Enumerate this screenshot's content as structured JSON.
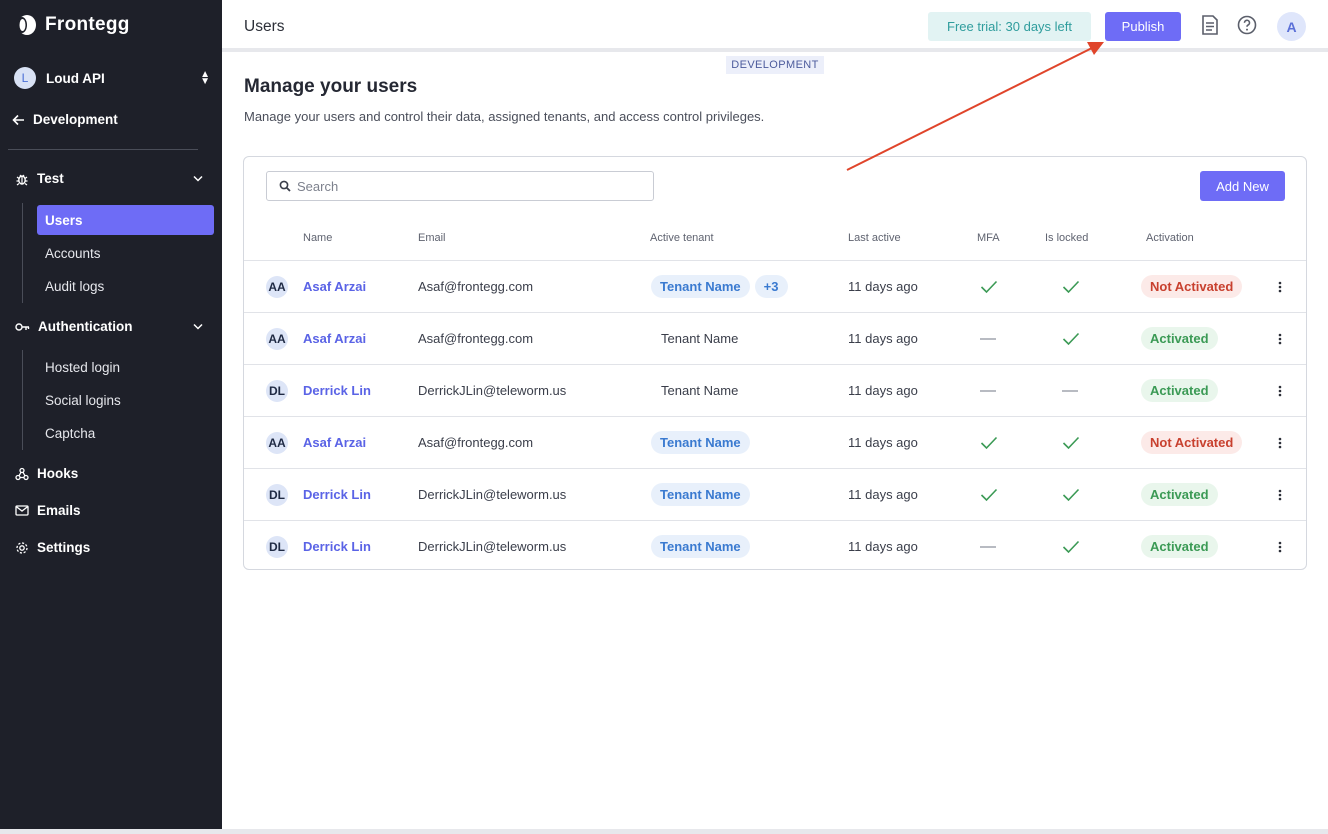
{
  "sidebar": {
    "brand": "Frontegg",
    "app": {
      "initial": "L",
      "name": "Loud API"
    },
    "environment": "Development",
    "sections": {
      "test": {
        "label": "Test",
        "items": [
          "Users",
          "Accounts",
          "Audit logs"
        ]
      },
      "authentication": {
        "label": "Authentication",
        "items": [
          "Hosted login",
          "Social logins",
          "Captcha"
        ]
      },
      "hooks": "Hooks",
      "emails": "Emails",
      "settings": "Settings"
    },
    "active_item": "Users"
  },
  "header": {
    "title": "Users",
    "trial": "Free trial: 30 days left",
    "publish": "Publish",
    "avatar_initial": "A"
  },
  "env_tag": "DEVELOPMENT",
  "main": {
    "title": "Manage your users",
    "subtitle": "Manage your users and control their data, assigned tenants, and access control privileges."
  },
  "toolbar": {
    "search_placeholder": "Search",
    "add_new": "Add New"
  },
  "table": {
    "columns": [
      "Name",
      "Email",
      "Active tenant",
      "Last active",
      "MFA",
      "Is locked",
      "Activation"
    ],
    "rows": [
      {
        "initials": "AA",
        "name": "Asaf Arzai",
        "email": "Asaf@frontegg.com",
        "tenant": "Tenant Name",
        "tenant_style": "pill",
        "extra": "+3",
        "last": "11 days ago",
        "mfa": true,
        "locked": true,
        "activation": "Not Activated"
      },
      {
        "initials": "AA",
        "name": "Asaf Arzai",
        "email": "Asaf@frontegg.com",
        "tenant": "Tenant Name",
        "tenant_style": "plain",
        "extra": "",
        "last": "11 days ago",
        "mfa": false,
        "locked": true,
        "activation": "Activated"
      },
      {
        "initials": "DL",
        "name": "Derrick Lin",
        "email": "DerrickJLin@teleworm.us",
        "tenant": "Tenant Name",
        "tenant_style": "plain",
        "extra": "",
        "last": "11 days ago",
        "mfa": false,
        "locked": false,
        "activation": "Activated"
      },
      {
        "initials": "AA",
        "name": "Asaf Arzai",
        "email": "Asaf@frontegg.com",
        "tenant": "Tenant Name",
        "tenant_style": "pill",
        "extra": "",
        "last": "11 days ago",
        "mfa": true,
        "locked": true,
        "activation": "Not Activated"
      },
      {
        "initials": "DL",
        "name": "Derrick Lin",
        "email": "DerrickJLin@teleworm.us",
        "tenant": "Tenant Name",
        "tenant_style": "pill",
        "extra": "",
        "last": "11 days ago",
        "mfa": true,
        "locked": true,
        "activation": "Activated"
      },
      {
        "initials": "DL",
        "name": "Derrick Lin",
        "email": "DerrickJLin@teleworm.us",
        "tenant": "Tenant Name",
        "tenant_style": "pill",
        "extra": "",
        "last": "11 days ago",
        "mfa": false,
        "locked": true,
        "activation": "Activated"
      }
    ]
  },
  "colors": {
    "sidebar_bg": "#1e2029",
    "accent": "#6e6cf6",
    "success": "#3b9a55",
    "danger": "#c8402e",
    "annotation_arrow": "#e0452b"
  },
  "annotation": {
    "type": "arrow",
    "points_to": "publish-button"
  }
}
